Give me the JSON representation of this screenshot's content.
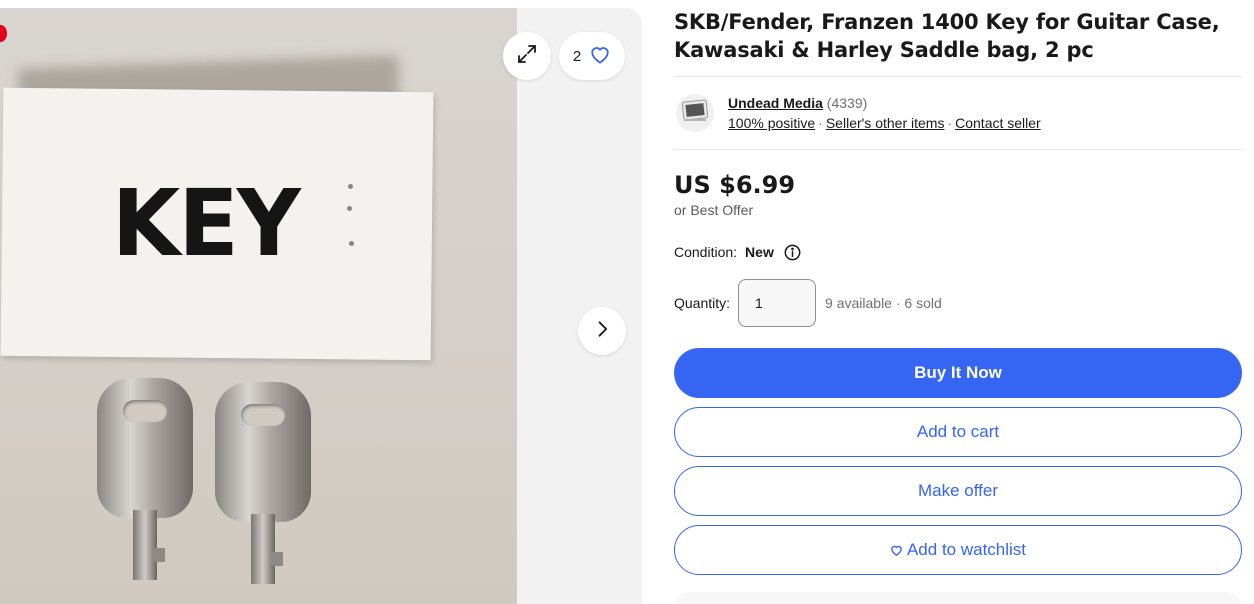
{
  "gallery": {
    "photo_text": "KEY",
    "watch_count": "2",
    "icons": {
      "expand": "expand-icon",
      "watch": "heart-icon",
      "next": "chevron-right-icon"
    }
  },
  "listing": {
    "title": "SKB/Fender, Franzen 1400 Key for Guitar Case, Kawasaki & Harley Saddle bag, 2 pc"
  },
  "seller": {
    "name": "Undead Media",
    "feedback_count": "(4339)",
    "positive": "100% positive",
    "separator": "·",
    "other_items": "Seller's other items",
    "contact": "Contact seller"
  },
  "pricing": {
    "price": "US $6.99",
    "best_offer": "or Best Offer"
  },
  "condition": {
    "label": "Condition:",
    "value": "New"
  },
  "quantity": {
    "label": "Quantity:",
    "value": "1",
    "available": "9 available",
    "separator": "·",
    "sold": "6 sold"
  },
  "actions": {
    "buy_now": "Buy It Now",
    "add_to_cart": "Add to cart",
    "make_offer": "Make offer",
    "add_to_watchlist": "Add to watchlist"
  },
  "colors": {
    "accent": "#3665f3",
    "text": "#191919",
    "muted": "#707070"
  }
}
